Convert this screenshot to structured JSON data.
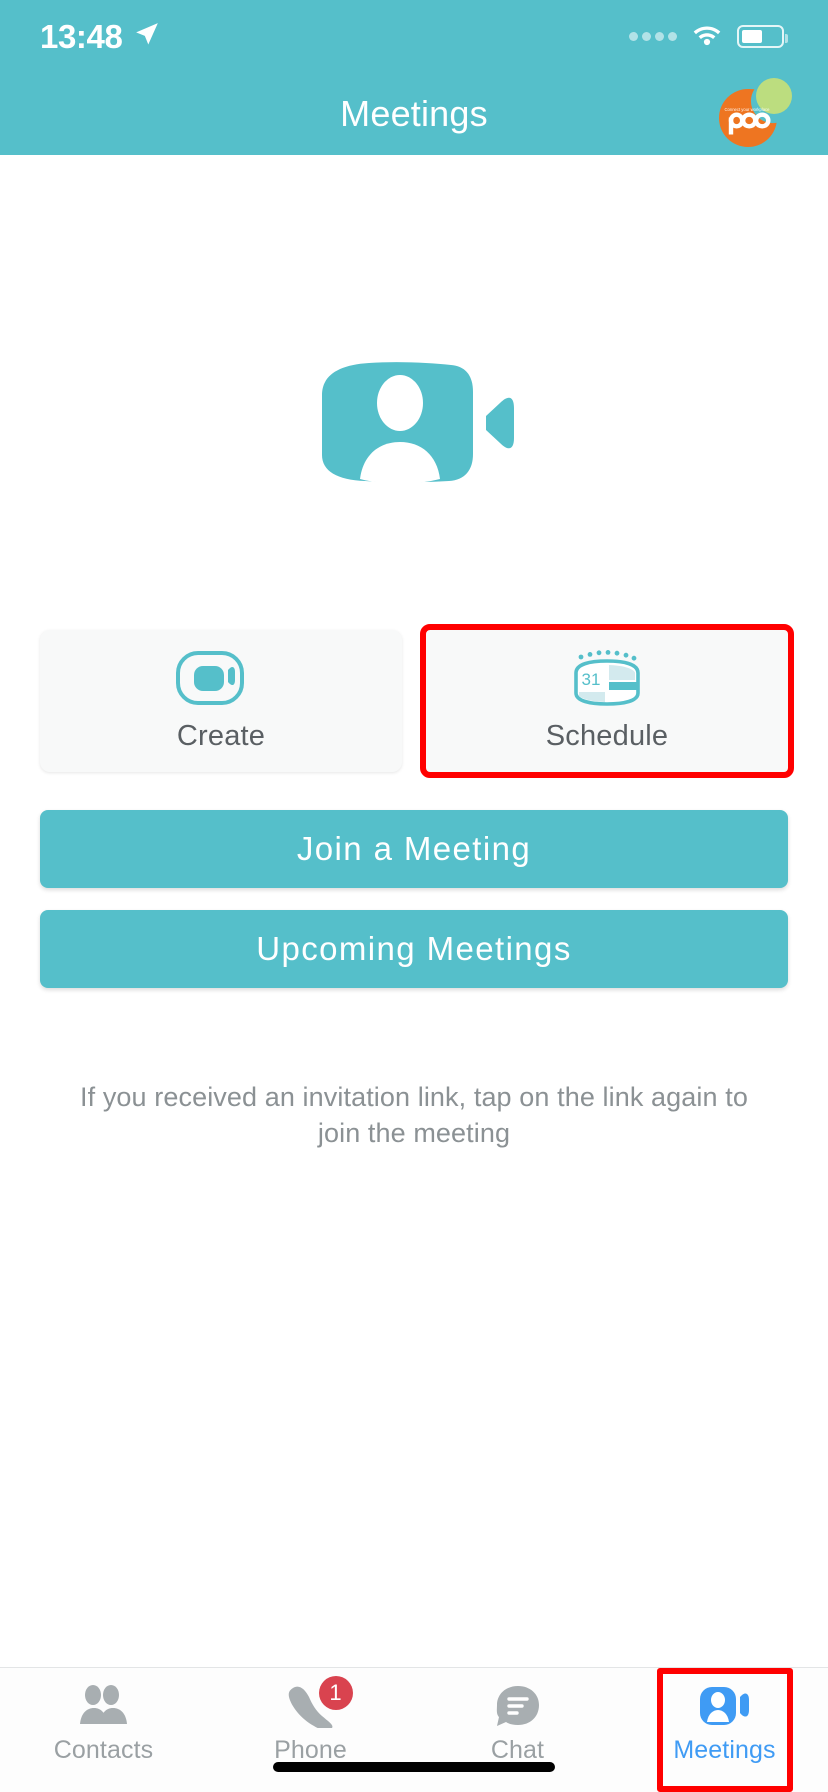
{
  "status_bar": {
    "time": "13:48",
    "location_icon": "location-arrow-icon",
    "signal_icon": "signal-dots-icon",
    "wifi_icon": "wifi-icon",
    "battery_icon": "battery-icon"
  },
  "header": {
    "title": "Meetings",
    "avatar_icon": "avatar-logo-icon",
    "avatar_text": "poo",
    "avatar_tagline": "Connect your workplace",
    "background_color": "#55bfca"
  },
  "hero": {
    "icon": "video-person-icon",
    "color": "#55bfca"
  },
  "cards": [
    {
      "label": "Create",
      "icon": "video-camera-icon",
      "highlighted": false
    },
    {
      "label": "Schedule",
      "icon": "calendar-31-icon",
      "highlighted": true
    }
  ],
  "actions": [
    {
      "label": "Join a Meeting"
    },
    {
      "label": "Upcoming Meetings"
    }
  ],
  "helper_text": "If you received an invitation link, tap on the link again to join the meeting",
  "tabs": [
    {
      "label": "Contacts",
      "icon": "contacts-people-icon",
      "active": false,
      "badge": "",
      "highlighted": false
    },
    {
      "label": "Phone",
      "icon": "phone-handset-icon",
      "active": false,
      "badge": "1",
      "highlighted": false
    },
    {
      "label": "Chat",
      "icon": "chat-bubble-icon",
      "active": false,
      "badge": "",
      "highlighted": false
    },
    {
      "label": "Meetings",
      "icon": "meetings-video-icon",
      "active": true,
      "badge": "",
      "highlighted": true
    }
  ],
  "colors": {
    "brand_teal": "#55bfca",
    "active_blue": "#3f9bf4",
    "badge_red": "#d9434f",
    "highlight_red": "#ff0000",
    "inactive_gray": "#9aa0a3"
  }
}
